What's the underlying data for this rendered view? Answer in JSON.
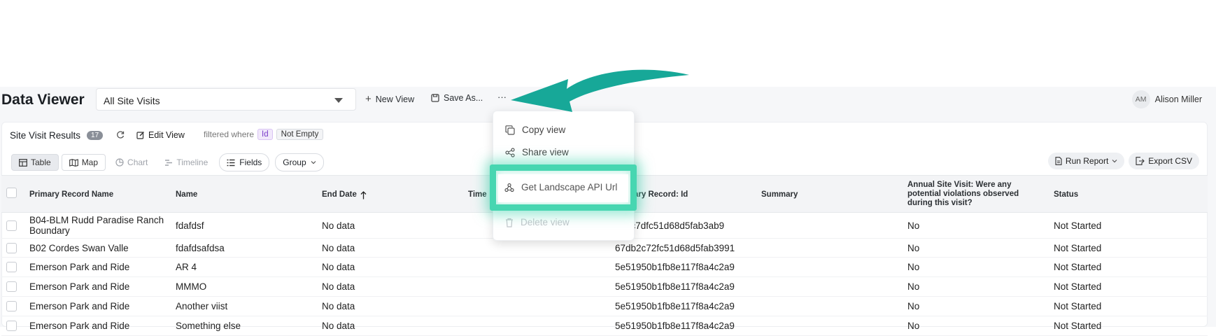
{
  "header": {
    "title": "Data Viewer",
    "view_select": "All Site Visits",
    "new_view": "New View",
    "save_as": "Save As...",
    "more": "···",
    "user_initials": "AM",
    "user_name": "Alison Miller"
  },
  "panel": {
    "title": "Site Visit Results",
    "count": "17",
    "edit_view": "Edit View",
    "filter_prefix": "filtered where",
    "filter_field": "Id",
    "filter_op": "Not Empty"
  },
  "tabs": {
    "table": "Table",
    "map": "Map",
    "chart": "Chart",
    "timeline": "Timeline",
    "fields": "Fields",
    "group": "Group",
    "run_report": "Run Report",
    "export_csv": "Export CSV"
  },
  "columns": {
    "c1": "Primary Record Name",
    "c2": "Name",
    "c3": "End Date",
    "c4": "Time",
    "c5": "ary Record: Id",
    "c6": "Summary",
    "c7": "Annual Site Visit: Were any potential violations observed during this visit?",
    "c8": "Status"
  },
  "rows": [
    {
      "c1": "B04-BLM Rudd Paradise Ranch Boundary",
      "c2": "fdafdsf",
      "c3": "No data",
      "c5": "2b2c7dfc51d68d5fab3ab9",
      "c7": "No",
      "c8": "Not Started"
    },
    {
      "c1": "B02 Cordes Swan Valle",
      "c2": "fdafdsafdsa",
      "c3": "No data",
      "c5": "67db2c72fc51d68d5fab3991",
      "c7": "No",
      "c8": "Not Started"
    },
    {
      "c1": "Emerson Park and Ride",
      "c2": "AR 4",
      "c3": "No data",
      "c5": "5e51950b1fb8e117f8a4c2a9",
      "c7": "No",
      "c8": "Not Started"
    },
    {
      "c1": "Emerson Park and Ride",
      "c2": "MMMO",
      "c3": "No data",
      "c5": "5e51950b1fb8e117f8a4c2a9",
      "c7": "No",
      "c8": "Not Started"
    },
    {
      "c1": "Emerson Park and Ride",
      "c2": "Another viist",
      "c3": "No data",
      "c5": "5e51950b1fb8e117f8a4c2a9",
      "c7": "No",
      "c8": "Not Started"
    },
    {
      "c1": "Emerson Park and Ride",
      "c2": "Something else",
      "c3": "No data",
      "c5": "5e51950b1fb8e117f8a4c2a9",
      "c7": "No",
      "c8": "Not Started"
    }
  ],
  "menu": {
    "copy_view": "Copy view",
    "share_view": "Share view",
    "get_api_url": "Get Landscape API Url",
    "delete_view": "Delete view"
  },
  "colors": {
    "accent_teal": "#17a898",
    "highlight_glow": "#47d6b1",
    "filter_chip": "#7a3cc9"
  }
}
